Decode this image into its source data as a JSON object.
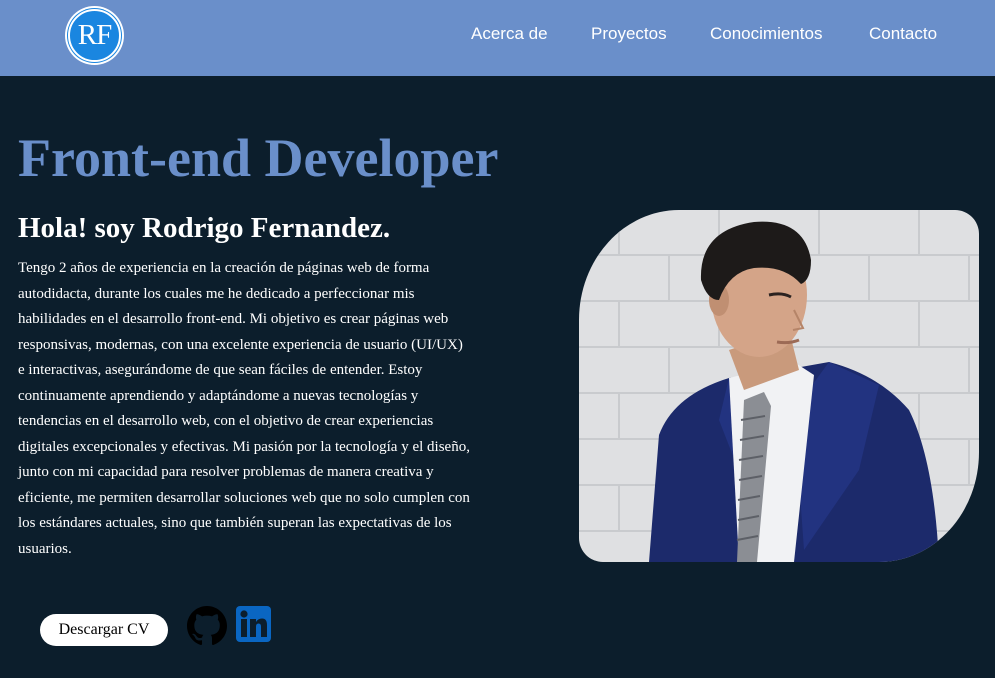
{
  "header": {
    "logo_text": "RF",
    "nav": [
      "Acerca de",
      "Proyectos",
      "Conocimientos",
      "Contacto"
    ]
  },
  "hero": {
    "role": "Front-end Developer",
    "greeting": "Hola! soy Rodrigo Fernandez.",
    "bio": "Tengo 2 años de experiencia en la creación de páginas web de forma autodidacta, durante los cuales me he dedicado a perfeccionar mis habilidades en el desarrollo front-end. Mi objetivo es crear páginas web responsivas, modernas, con una excelente experiencia de usuario (UI/UX) e interactivas, asegurándome de que sean fáciles de entender. Estoy continuamente aprendiendo y adaptándome a nuevas tecnologías y tendencias en el desarrollo web, con el objetivo de crear experiencias digitales excepcionales y efectivas. Mi pasión por la tecnología y el diseño, junto con mi capacidad para resolver problemas de manera creativa y eficiente, me permiten desarrollar soluciones web que no solo cumplen con los estándares actuales, sino que también superan las expectativas de los usuarios.",
    "cv_button": "Descargar CV",
    "social": {
      "github_icon": "github-icon",
      "linkedin_icon": "linkedin-icon"
    }
  },
  "colors": {
    "header_bg": "#6a8fca",
    "page_bg": "#0c1e2c",
    "accent": "#6a8fca",
    "logo_blue": "#1a86e0",
    "linkedin_blue": "#0a66c2"
  }
}
